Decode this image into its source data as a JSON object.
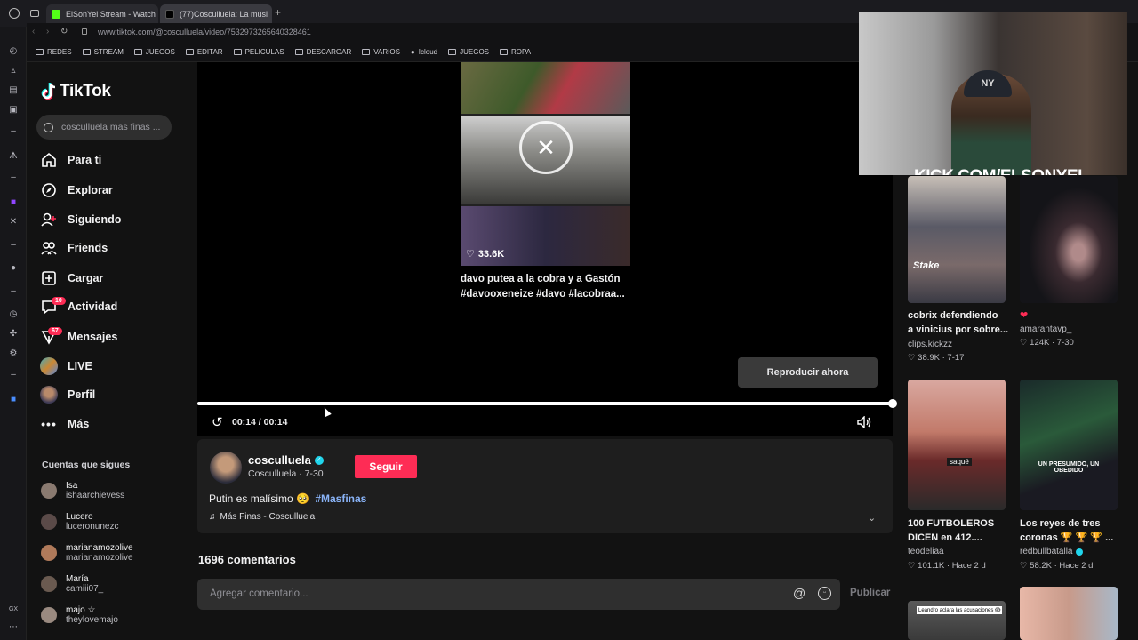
{
  "browser": {
    "tabs": [
      {
        "title": "ElSonYei Stream - Watch"
      },
      {
        "title": "(77)Cosculluela: La músi"
      }
    ],
    "url": "www.tiktok.com/@cosculluela/video/7532973265640328461",
    "bookmarks": [
      "REDES",
      "STREAM",
      "JUEGOS",
      "EDITAR",
      "PELICULAS",
      "DESCARGAR",
      "VARIOS",
      "Icloud",
      "JUEGOS",
      "ROPA"
    ]
  },
  "tiktok": {
    "logo": "TikTok",
    "search_placeholder": "cosculluela mas finas ...",
    "nav": [
      {
        "label": "Para ti",
        "icon": "home-icon"
      },
      {
        "label": "Explorar",
        "icon": "compass-icon"
      },
      {
        "label": "Siguiendo",
        "icon": "following-icon"
      },
      {
        "label": "Friends",
        "icon": "friends-icon"
      },
      {
        "label": "Cargar",
        "icon": "upload-icon"
      },
      {
        "label": "Actividad",
        "icon": "activity-icon",
        "badge": "10"
      },
      {
        "label": "Mensajes",
        "icon": "messages-icon",
        "badge": "67"
      },
      {
        "label": "LIVE",
        "icon": "live-icon"
      },
      {
        "label": "Perfil",
        "icon": "profile-icon"
      },
      {
        "label": "Más",
        "icon": "more-icon"
      }
    ],
    "following_heading": "Cuentas que sigues",
    "following": [
      {
        "name": "Isa",
        "handle": "ishaarchievess"
      },
      {
        "name": "Lucero",
        "handle": "luceronunezc"
      },
      {
        "name": "marianamozolive",
        "handle": "marianamozolive"
      },
      {
        "name": "María",
        "handle": "camiii07_"
      },
      {
        "name": "majo ☆",
        "handle": "theylovemajo"
      }
    ]
  },
  "video": {
    "overlay_likes": "33.6K",
    "overlay_caption_line1": "davo putea a la cobra y a Gastón",
    "overlay_caption_line2": "#davooxeneize #davo #lacobraa...",
    "play_now": "Reproducir ahora",
    "time": "00:14 / 00:14",
    "progress": 1.0
  },
  "author": {
    "name": "cosculluela",
    "subtitle": "Cosculluela · 7-30",
    "follow_button": "Seguir",
    "caption": "Putin es malísimo 🥺",
    "hashtag": "#Masfinas",
    "music": "Más Finas - Cosculluela"
  },
  "comments": {
    "count_label": "1696 comentarios",
    "input_placeholder": "Agregar comentario...",
    "publish": "Publicar"
  },
  "webcam": {
    "overlay_text": "KICK.COM/ELSONYEI"
  },
  "related": [
    {
      "title_line1": "cobrix defendiendo",
      "title_line2": "a vinicius por sobre...",
      "author": "clips.kickzz",
      "stats": "38.9K · 7-17",
      "thumb_text": "Stake"
    },
    {
      "title_line1": "❤",
      "title_line2": "",
      "author": "amarantavp_",
      "stats": "124K · 7-30"
    },
    {
      "title_line1": "100 FUTBOLEROS",
      "title_line2": "DICEN en 412....",
      "author": "teodeliaa",
      "stats": "101.1K · Hace 2 d",
      "thumb_text": "saqué"
    },
    {
      "title_line1": "Los reyes de tres",
      "title_line2": "coronas 🏆 🏆 🏆 ...",
      "author": "redbullbatalla",
      "stats": "58.2K · Hace 2 d",
      "thumb_text": "UN PRESUMIDO, UN OBEDIDO"
    },
    {
      "thumb_text": "Leandro aclara las acusaciones 😱"
    }
  ],
  "colors": {
    "accent": "#fe2c55",
    "bg": "#121212",
    "verified": "#20d5ec",
    "hashtag": "#8ab4f8"
  }
}
